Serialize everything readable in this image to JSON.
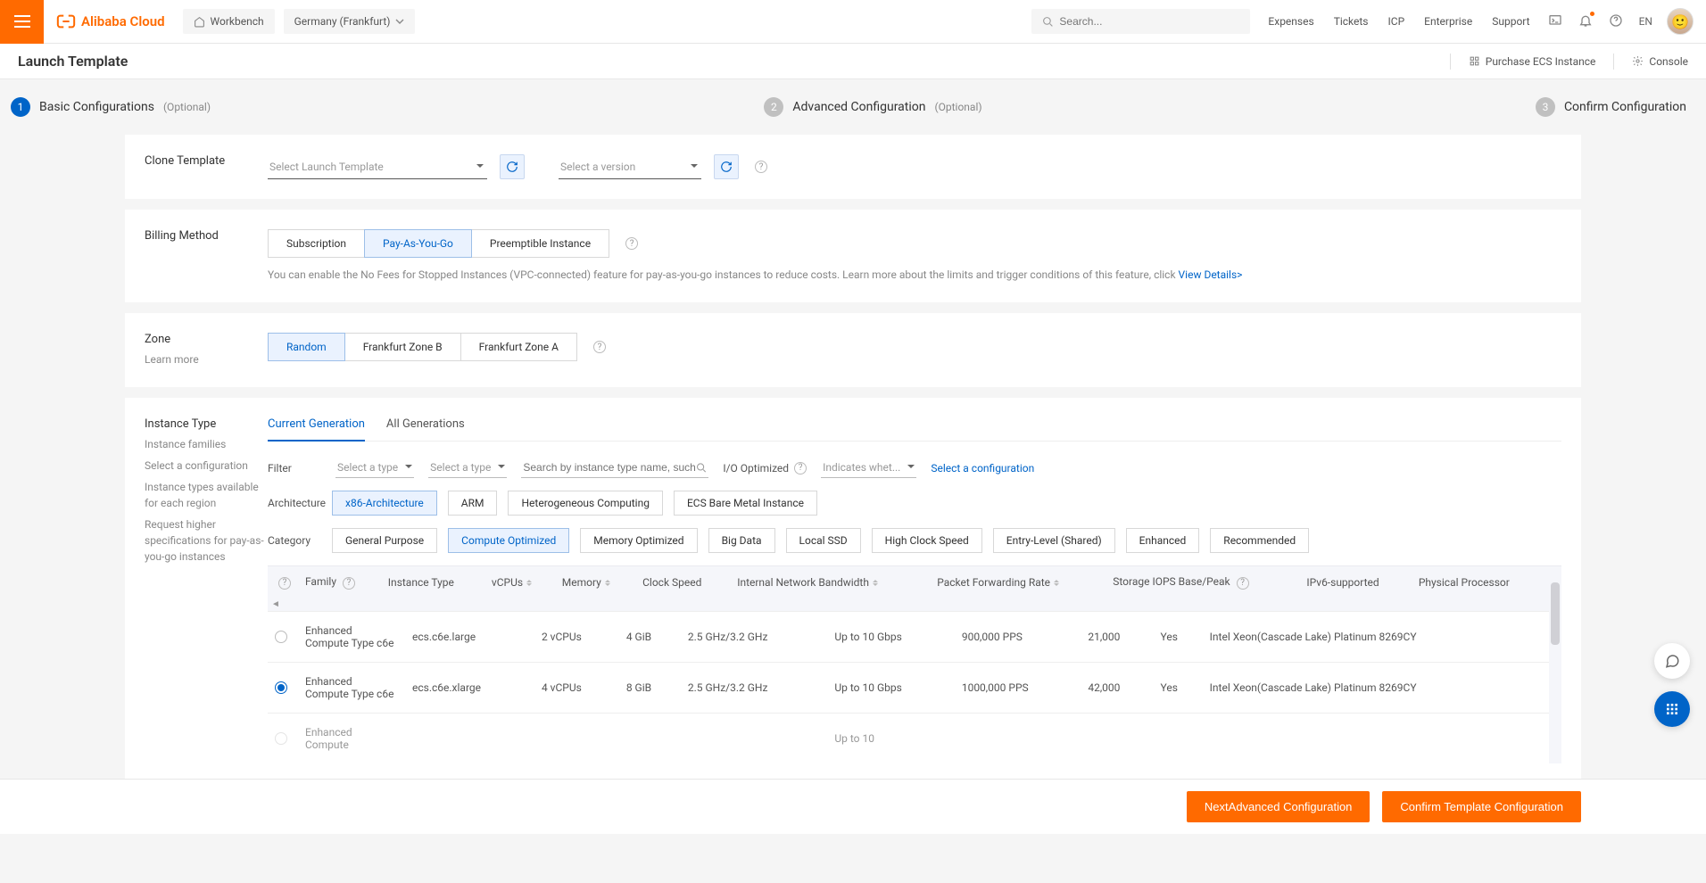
{
  "topbar": {
    "workbench": "Workbench",
    "region": "Germany (Frankfurt)",
    "search_placeholder": "Search...",
    "links": [
      "Expenses",
      "Tickets",
      "ICP",
      "Enterprise",
      "Support"
    ],
    "lang": "EN"
  },
  "subbar": {
    "title": "Launch Template",
    "purchase": "Purchase ECS Instance",
    "console": "Console"
  },
  "steps": [
    {
      "num": "1",
      "label": "Basic Configurations",
      "optional": "(Optional)",
      "active": true
    },
    {
      "num": "2",
      "label": "Advanced Configuration",
      "optional": "(Optional)",
      "active": false
    },
    {
      "num": "3",
      "label": "Confirm Configuration",
      "optional": "",
      "active": false
    }
  ],
  "clone": {
    "label": "Clone Template",
    "select_template": "Select Launch Template",
    "select_version": "Select a version"
  },
  "billing": {
    "label": "Billing Method",
    "options": [
      "Subscription",
      "Pay-As-You-Go",
      "Preemptible Instance"
    ],
    "selected": 1,
    "hint_pre": "You can enable the No Fees for Stopped Instances (VPC-connected) feature for pay-as-you-go instances to reduce costs. Learn more about the limits and trigger conditions of this feature, click ",
    "hint_link": "View Details>"
  },
  "zone": {
    "label": "Zone",
    "learn": "Learn more",
    "options": [
      "Random",
      "Frankfurt Zone B",
      "Frankfurt Zone A"
    ],
    "selected": 0
  },
  "instance": {
    "label": "Instance Type",
    "side_links": [
      "Instance families",
      "Select a configuration",
      "Instance types available for each region",
      "Request higher specifications for pay-as-you-go instances"
    ],
    "tabs": [
      "Current Generation",
      "All Generations"
    ],
    "tab_selected": 0,
    "filter_label": "Filter",
    "filter_vcpu": "Select a type",
    "filter_mem": "Select a type",
    "filter_search_placeholder": "Search by instance type name, such a",
    "io_opt": "I/O Optimized",
    "indicates": "Indicates whet...",
    "select_config": "Select a configuration",
    "arch_label": "Architecture",
    "arch": [
      "x86-Architecture",
      "ARM",
      "Heterogeneous Computing",
      "ECS Bare Metal Instance"
    ],
    "arch_selected": 0,
    "cat_label": "Category",
    "cat": [
      "General Purpose",
      "Compute Optimized",
      "Memory Optimized",
      "Big Data",
      "Local SSD",
      "High Clock Speed",
      "Entry-Level (Shared)",
      "Enhanced",
      "Recommended"
    ],
    "cat_selected": 1,
    "columns": [
      "Family",
      "Instance Type",
      "vCPUs",
      "Memory",
      "Clock Speed",
      "Internal Network Bandwidth",
      "Packet Forwarding Rate",
      "Storage IOPS Base/Peak",
      "IPv6-supported",
      "Physical Processor"
    ],
    "rows": [
      {
        "sel": false,
        "family": "Enhanced Compute Type c6e",
        "type": "ecs.c6e.large",
        "vcpu": "2 vCPUs",
        "mem": "4 GiB",
        "clock": "2.5 GHz/3.2 GHz",
        "bw": "Up to 10 Gbps",
        "pps": "900,000 PPS",
        "iops": "21,000",
        "ipv6": "Yes",
        "cpu": "Intel Xeon(Cascade Lake) Platinum 8269CY"
      },
      {
        "sel": true,
        "family": "Enhanced Compute Type c6e",
        "type": "ecs.c6e.xlarge",
        "vcpu": "4 vCPUs",
        "mem": "8 GiB",
        "clock": "2.5 GHz/3.2 GHz",
        "bw": "Up to 10 Gbps",
        "pps": "1000,000 PPS",
        "iops": "42,000",
        "ipv6": "Yes",
        "cpu": "Intel Xeon(Cascade Lake) Platinum 8269CY"
      }
    ],
    "row_cut": {
      "family": "Enhanced Compute",
      "bw": "Up to 10"
    }
  },
  "footer": {
    "next": "NextAdvanced Configuration",
    "confirm": "Confirm Template Configuration"
  }
}
